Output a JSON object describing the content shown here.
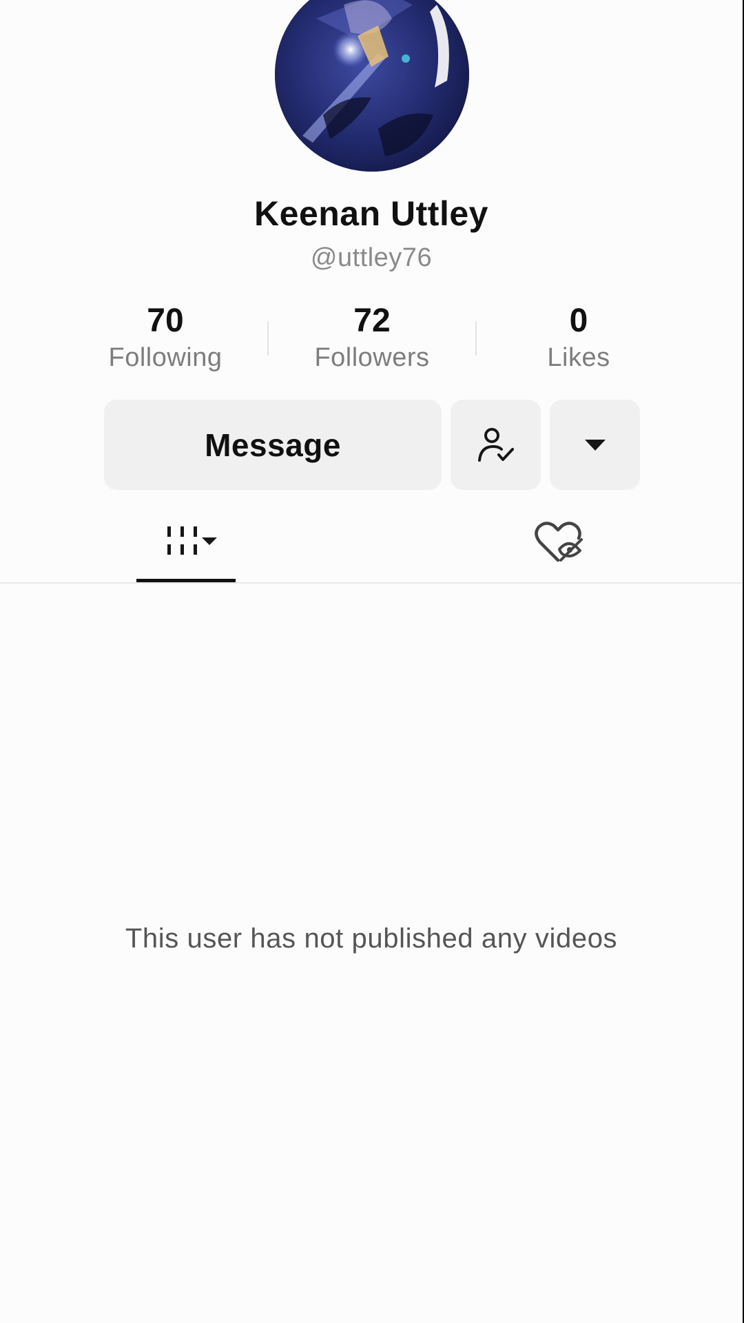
{
  "profile": {
    "display_name": "Keenan Uttley",
    "handle": "@uttley76"
  },
  "stats": [
    {
      "value": "70",
      "label": "Following"
    },
    {
      "value": "72",
      "label": "Followers"
    },
    {
      "value": "0",
      "label": "Likes"
    }
  ],
  "actions": {
    "message_label": "Message",
    "following_icon": "person-check-icon",
    "more_icon": "caret-down-icon"
  },
  "tabs": {
    "videos_icon": "videos-grid-sort-icon",
    "liked_icon": "liked-hidden-icon",
    "active": "videos"
  },
  "content": {
    "empty_message": "This user has not published any videos"
  },
  "colors": {
    "background": "#fcfcfc",
    "button_bg": "#f0f0f0",
    "text_primary": "#111111",
    "text_secondary": "#7d7d7d"
  }
}
